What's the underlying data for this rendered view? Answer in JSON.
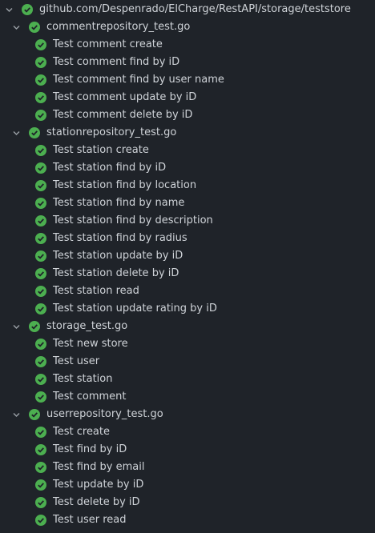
{
  "colors": {
    "background": "#1f2329",
    "text": "#cfd3d8",
    "pass": "#4caf50",
    "chevron": "#9aa0a6"
  },
  "root": {
    "label": "github.com/Despenrado/ElCharge/RestAPI/storage/teststore",
    "status": "passed",
    "icon": "check-circle-icon"
  },
  "files": [
    {
      "label": "commentrepository_test.go",
      "status": "passed",
      "tests": [
        "Test comment create",
        "Test comment find by iD",
        "Test comment find by user name",
        "Test comment update by iD",
        "Test comment delete by iD"
      ]
    },
    {
      "label": "stationrepository_test.go",
      "status": "passed",
      "tests": [
        "Test station create",
        "Test station find by iD",
        "Test station find by location",
        "Test station find by name",
        "Test station find by description",
        "Test station find by radius",
        "Test station update by iD",
        "Test station delete by iD",
        "Test station read",
        "Test station update rating by iD"
      ]
    },
    {
      "label": "storage_test.go",
      "status": "passed",
      "tests": [
        "Test new store",
        "Test user",
        "Test station",
        "Test comment"
      ]
    },
    {
      "label": "userrepository_test.go",
      "status": "passed",
      "tests": [
        "Test create",
        "Test find by iD",
        "Test find by email",
        "Test update by iD",
        "Test delete by iD",
        "Test user read"
      ]
    }
  ]
}
